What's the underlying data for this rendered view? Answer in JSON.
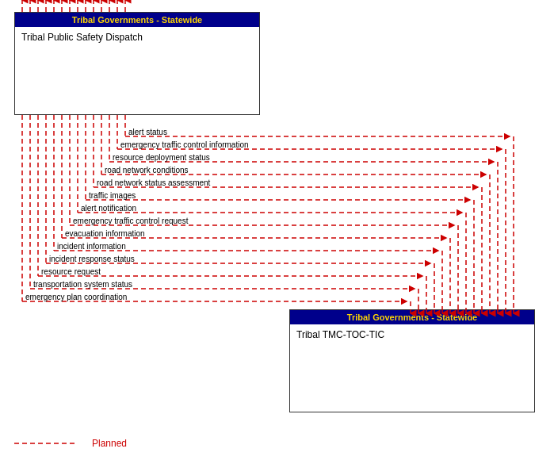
{
  "boxes": {
    "dispatch": {
      "header": "Tribal Governments - Statewide",
      "body": "Tribal Public Safety Dispatch"
    },
    "tmc": {
      "header": "Tribal Governments - Statewide",
      "body": "Tribal TMC-TOC-TIC"
    }
  },
  "flows_right": [
    "alert status",
    "emergency traffic control information",
    "resource deployment status",
    "road network conditions",
    "road network status assessment",
    "traffic images",
    "alert notification",
    "emergency traffic control request",
    "evacuation information",
    "incident information",
    "incident response status",
    "resource request",
    "transportation system status",
    "emergency plan coordination"
  ],
  "legend": {
    "line_style": "dashed",
    "label": "Planned"
  }
}
